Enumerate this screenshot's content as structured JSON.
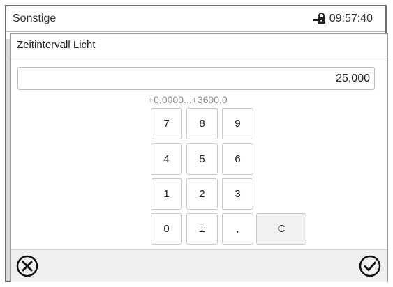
{
  "header": {
    "title": "Sonstige",
    "time": "09:57:40",
    "lock_icon": "door-lock-icon"
  },
  "dialog": {
    "title": "Zeitintervall Licht",
    "value": "25,000",
    "range_hint": "+0,0000...+3600,0"
  },
  "keypad": {
    "keys": [
      "7",
      "8",
      "9",
      "4",
      "5",
      "6",
      "1",
      "2",
      "3",
      "0",
      "±",
      ","
    ],
    "clear_label": "C"
  },
  "footer": {
    "cancel_icon": "close-circle-icon",
    "confirm_icon": "check-circle-icon"
  }
}
